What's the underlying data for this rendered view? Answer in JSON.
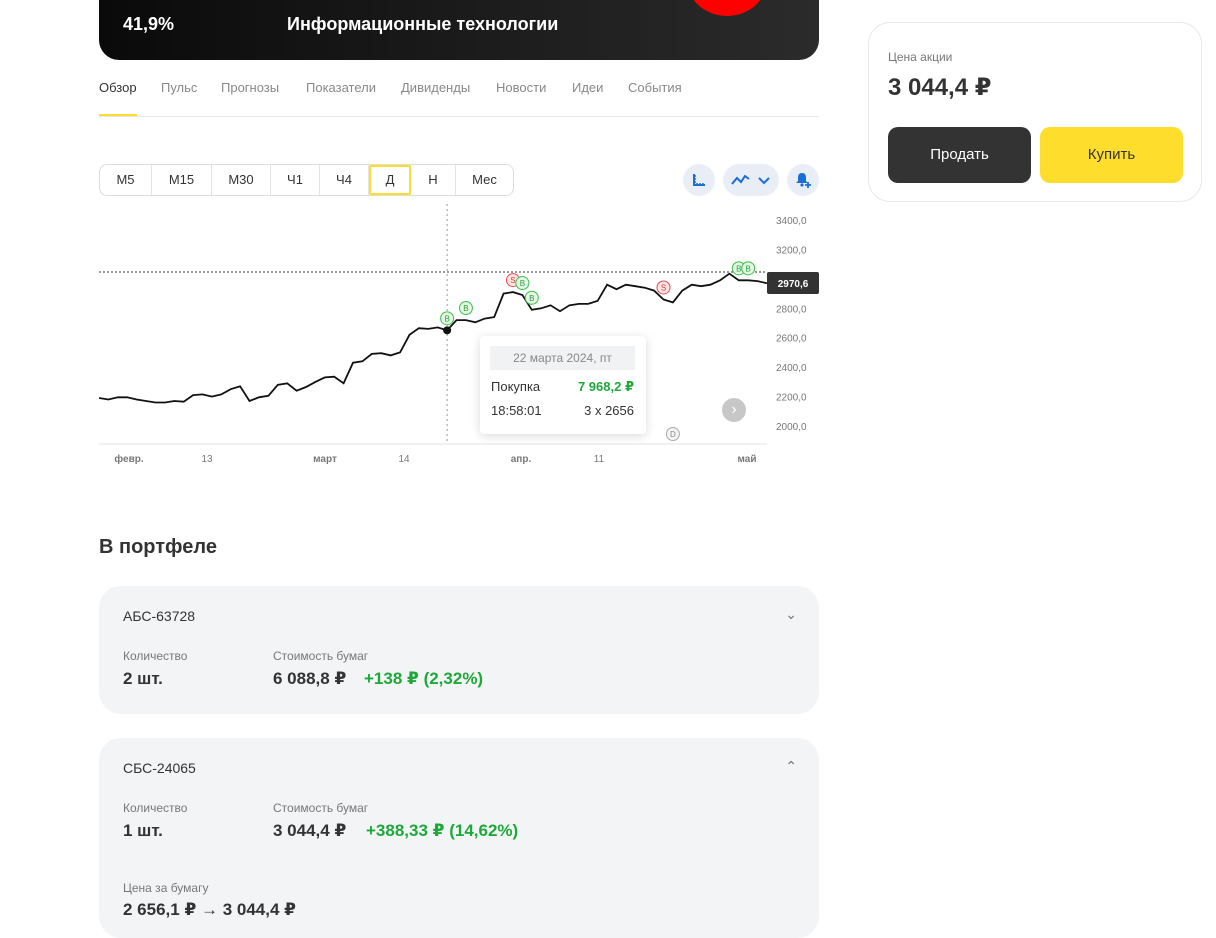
{
  "hero": {
    "percent": "41,9%",
    "sector": "Информационные технологии"
  },
  "tabs": [
    "Обзор",
    "Пульс",
    "Прогнозы",
    "Показатели",
    "Дивиденды",
    "Новости",
    "Идеи",
    "События"
  ],
  "timeframes": [
    "М5",
    "М15",
    "М30",
    "Ч1",
    "Ч4",
    "Д",
    "Н",
    "Мес"
  ],
  "active_timeframe": "Д",
  "tools": [
    "ruler-icon",
    "line-chart-icon",
    "bell-plus-icon"
  ],
  "chart_data": {
    "type": "line",
    "y_ticks": [
      "3400,0",
      "3200,0",
      "3000,0",
      "2800,0",
      "2600,0",
      "2400,0",
      "2200,0",
      "2000,0"
    ],
    "ylim": [
      1950,
      3500
    ],
    "x_ticks": [
      "февр.",
      "13",
      "март",
      "14",
      "апр.",
      "11",
      "май"
    ],
    "last_value_label": "2970,6",
    "last_value": 2970.6,
    "series": [
      {
        "values": [
          2190,
          2180,
          2195,
          2195,
          2180,
          2170,
          2160,
          2160,
          2170,
          2165,
          2210,
          2215,
          2200,
          2215,
          2250,
          2270,
          2170,
          2195,
          2205,
          2280,
          2290,
          2240,
          2265,
          2300,
          2330,
          2335,
          2290,
          2430,
          2440,
          2490,
          2495,
          2480,
          2500,
          2620,
          2665,
          2660,
          2670,
          2650,
          2720,
          2720,
          2705,
          2730,
          2740,
          2900,
          2910,
          2890,
          2790,
          2800,
          2820,
          2780,
          2820,
          2830,
          2830,
          2850,
          2960,
          2930,
          2960,
          2950,
          2940,
          2920,
          2860,
          2840,
          2920,
          2960,
          2950,
          2960,
          2990,
          3035,
          2990,
          2990,
          2985,
          2970
        ]
      }
    ],
    "markers": [
      {
        "type": "B",
        "index": 37
      },
      {
        "type": "B",
        "index": 39
      },
      {
        "type": "S",
        "index": 44
      },
      {
        "type": "B",
        "index": 45
      },
      {
        "type": "B",
        "index": 46
      },
      {
        "type": "S",
        "index": 60
      },
      {
        "type": "B",
        "index": 68
      },
      {
        "type": "B",
        "index": 69
      },
      {
        "type": "D",
        "index": 61
      }
    ],
    "hover_index": 37
  },
  "tooltip": {
    "date": "22 марта 2024, пт",
    "label": "Покупка",
    "amount": "7 968,2 ₽",
    "time": "18:58:01",
    "qty": "3 x 2656"
  },
  "portfolio": {
    "title": "В портфеле",
    "cards": [
      {
        "account": "АБС-63728",
        "qty_label": "Количество",
        "qty": "2 шт.",
        "cost_label": "Стоимость бумаг",
        "cost": "6 088,8 ₽",
        "gain": "+138 ₽ (2,32%)",
        "expanded": false
      },
      {
        "account": "СБС-24065",
        "qty_label": "Количество",
        "qty": "1 шт.",
        "cost_label": "Стоимость бумаг",
        "cost": "3 044,4 ₽",
        "gain": "+388,33 ₽ (14,62%)",
        "expanded": true,
        "price_label": "Цена за бумагу",
        "price": "2 656,1 ₽ → 3 044,4 ₽"
      }
    ]
  },
  "side": {
    "price_label": "Цена акции",
    "price": "3 044,4 ₽",
    "sell": "Продать",
    "buy": "Купить"
  },
  "colors": {
    "accent": "#ffdd2d",
    "positive": "#1fa83a",
    "negative": "#e05050",
    "dark_button": "#333333"
  }
}
